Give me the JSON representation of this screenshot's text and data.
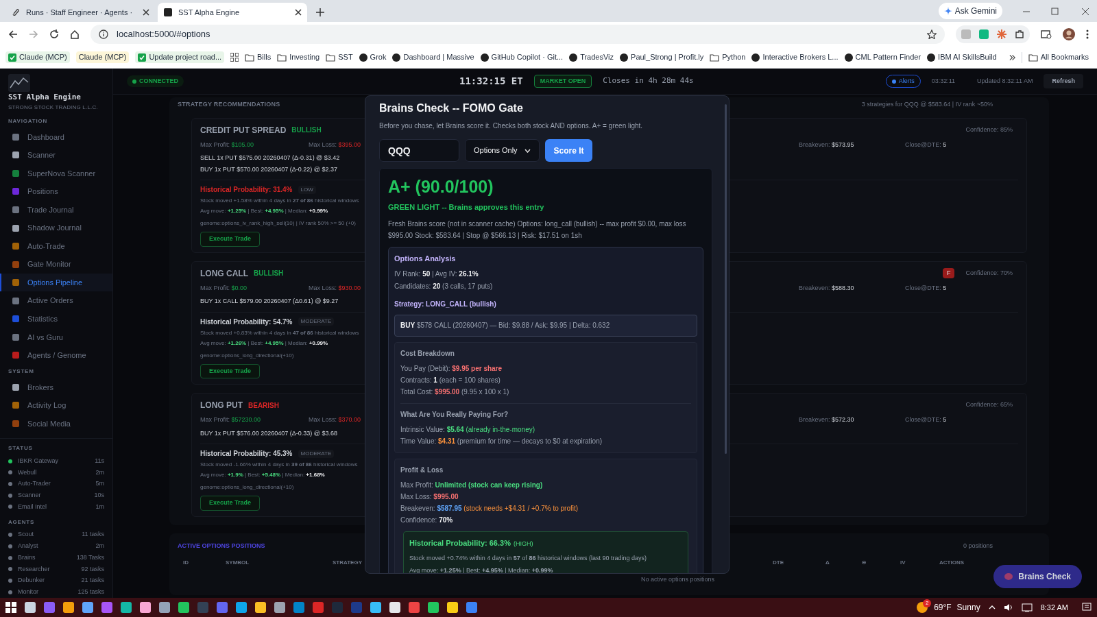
{
  "browser": {
    "tabs": [
      {
        "title": "Runs · Staff Engineer · Agents ·",
        "selected": false
      },
      {
        "title": "SST Alpha Engine",
        "selected": true
      }
    ],
    "address": "localhost:5000/#options",
    "profile_button": "Ask Gemini",
    "bookmarks": [
      {
        "label": "Claude (MCP)",
        "kind": "check"
      },
      {
        "label": "Claude (MCP)",
        "kind": "plain"
      },
      {
        "label": "Update project road...",
        "kind": "check"
      },
      {
        "kind": "apps"
      },
      {
        "label": "Bills",
        "kind": "folder"
      },
      {
        "label": "Investing",
        "kind": "folder"
      },
      {
        "label": "SST",
        "kind": "folder"
      },
      {
        "label": "Grok",
        "kind": "site"
      },
      {
        "label": "Dashboard | Massive",
        "kind": "site"
      },
      {
        "label": "GitHub Copilot · Git...",
        "kind": "site"
      },
      {
        "label": "TradesViz",
        "kind": "site"
      },
      {
        "label": "Paul_Strong | Profit.ly",
        "kind": "site"
      },
      {
        "label": "Python",
        "kind": "folder"
      },
      {
        "label": "Interactive Brokers L...",
        "kind": "site"
      },
      {
        "label": "CML Pattern Finder",
        "kind": "site"
      },
      {
        "label": "IBM AI SkillsBuild",
        "kind": "site"
      }
    ],
    "all_bookmarks": "All Bookmarks"
  },
  "sidebar": {
    "title": "SST Alpha Engine",
    "subtitle": "STRONG STOCK TRADING L.L.C.",
    "sections": [
      {
        "heading": "NAVIGATION",
        "items": [
          {
            "label": "Dashboard",
            "selected": false
          },
          {
            "label": "Scanner",
            "selected": false
          },
          {
            "label": "SuperNova Scanner",
            "selected": false
          },
          {
            "label": "Positions",
            "selected": false
          },
          {
            "label": "Trade Journal",
            "selected": false
          },
          {
            "label": "Shadow Journal",
            "selected": false
          },
          {
            "label": "Auto-Trade",
            "selected": false
          },
          {
            "label": "Gate Monitor",
            "selected": false
          },
          {
            "label": "Options Pipeline",
            "selected": true
          },
          {
            "label": "Active Orders",
            "selected": false
          },
          {
            "label": "Statistics",
            "selected": false
          },
          {
            "label": "AI vs Guru",
            "selected": false
          },
          {
            "label": "Agents / Genome",
            "selected": false
          }
        ]
      },
      {
        "heading": "SYSTEM",
        "items": [
          {
            "label": "Brokers",
            "selected": false
          },
          {
            "label": "Activity Log",
            "selected": false
          },
          {
            "label": "Social Media",
            "selected": false
          }
        ]
      }
    ],
    "status": {
      "heading": "STATUS",
      "items": [
        {
          "label": "IBKR Gateway",
          "value": "11s",
          "color": "#22c55e"
        },
        {
          "label": "Webull",
          "value": "2m",
          "color": "#6b7280"
        },
        {
          "label": "Auto-Trader",
          "value": "5m",
          "color": "#6b7280"
        },
        {
          "label": "Scanner",
          "value": "10s",
          "color": "#6b7280"
        },
        {
          "label": "Email Intel",
          "value": "1m",
          "color": "#6b7280"
        }
      ]
    },
    "agents": {
      "heading": "AGENTS",
      "items": [
        {
          "label": "Scout",
          "value": "11 tasks",
          "color": "#6b7280"
        },
        {
          "label": "Analyst",
          "value": "2m",
          "color": "#6b7280"
        },
        {
          "label": "Brains",
          "value": "138 Tasks",
          "color": "#6b7280"
        },
        {
          "label": "Researcher",
          "value": "92 tasks",
          "color": "#6b7280"
        },
        {
          "label": "Debunker",
          "value": "21 tasks",
          "color": "#6b7280"
        },
        {
          "label": "Monitor",
          "value": "125 tasks",
          "color": "#6b7280"
        }
      ]
    }
  },
  "header": {
    "connection": "CONNECTED",
    "clock": "11:32:15 ET",
    "market": "MARKET OPEN",
    "closes": "Closes in 4h 28m 44s",
    "alerts": "Alerts",
    "timer": "03:32:11",
    "updated": "Updated 8:32:11 AM",
    "refresh": "Refresh"
  },
  "strategies": {
    "heading": "STRATEGY RECOMMENDATIONS",
    "summary": "3 strategies for QQQ @ $583.64 | IV rank ~50%",
    "cards": [
      {
        "name": "CREDIT PUT SPREAD",
        "bias": {
          "label": "BULLISH",
          "color": "#16a34a"
        },
        "confidence": "Confidence: 85%",
        "max_profit": {
          "label": "Max Profit:",
          "value": "$105.00"
        },
        "max_loss": {
          "label": "Max Loss:",
          "value": "$395.00"
        },
        "breakeven": {
          "label": "Breakeven:",
          "value": "$573.95"
        },
        "close_dte": {
          "label": "Close@DTE:",
          "value": "5"
        },
        "legs": [
          "SELL 1x PUT $575.00 20260407 (Δ-0.31) @ $3.42",
          "BUY 1x PUT $570.00 20260407 (Δ-0.22) @ $2.37"
        ],
        "probability": {
          "label": "Historical Probability: 31.4%",
          "color": "#dc2626"
        },
        "probability_badge": "LOW",
        "moved": "Stock moved +1.58% within 4 days in **27 of 86** historical windows",
        "avg": [
          {
            "text": "Avg move: ",
            "kind": "dim"
          },
          {
            "text": "+1.25%",
            "kind": "green"
          },
          {
            "text": " | Best: ",
            "kind": "dim"
          },
          {
            "text": "+4.95%",
            "kind": "green"
          },
          {
            "text": " | Median: ",
            "kind": "dim"
          },
          {
            "text": "+0.99%",
            "kind": "bold"
          }
        ],
        "genome": "genome:options_iv_rank_high_sell(10) | IV rank 50% >= 50 (+0)",
        "button": "Execute Trade"
      },
      {
        "name": "LONG CALL",
        "bias": {
          "label": "BULLISH",
          "color": "#16a34a"
        },
        "grade": "F",
        "confidence": "Confidence: 70%",
        "max_profit": {
          "label": "Max Profit:",
          "value": "$0.00"
        },
        "max_loss": {
          "label": "Max Loss:",
          "value": "$930.00"
        },
        "breakeven": {
          "label": "Breakeven:",
          "value": "$588.30"
        },
        "close_dte": {
          "label": "Close@DTE:",
          "value": "5"
        },
        "legs": [
          "BUY 1x CALL $579.00 20260407 (Δ0.61) @ $9.27"
        ],
        "probability": {
          "label": "Historical Probability: 54.7%",
          "color": "#d1d5db"
        },
        "probability_badge": "MODERATE",
        "moved": "Stock moved +0.83% within 4 days in **47 of 86** historical windows",
        "avg": [
          {
            "text": "Avg move: ",
            "kind": "dim"
          },
          {
            "text": "+1.26%",
            "kind": "green"
          },
          {
            "text": " | Best: ",
            "kind": "dim"
          },
          {
            "text": "+4.95%",
            "kind": "green"
          },
          {
            "text": " | Median: ",
            "kind": "dim"
          },
          {
            "text": "+0.99%",
            "kind": "bold"
          }
        ],
        "genome": "genome:options_long_directional(+10)",
        "button": "Execute Trade"
      },
      {
        "name": "LONG PUT",
        "bias": {
          "label": "BEARISH",
          "color": "#dc2626"
        },
        "confidence": "Confidence: 65%",
        "max_profit": {
          "label": "Max Profit:",
          "value": "$57230.00"
        },
        "max_loss": {
          "label": "Max Loss:",
          "value": "$370.00"
        },
        "breakeven": {
          "label": "Breakeven:",
          "value": "$572.30"
        },
        "close_dte": {
          "label": "Close@DTE:",
          "value": "5"
        },
        "legs": [
          "BUY 1x PUT $576.00 20260407 (Δ-0.33) @ $3.68"
        ],
        "probability": {
          "label": "Historical Probability: 45.3%",
          "color": "#d1d5db"
        },
        "probability_badge": "MODERATE",
        "moved": "Stock moved -1.66% within 4 days in **39 of 86** historical windows",
        "avg": [
          {
            "text": "Avg move: ",
            "kind": "dim"
          },
          {
            "text": "+1.9%",
            "kind": "green"
          },
          {
            "text": " | Best: ",
            "kind": "dim"
          },
          {
            "text": "+5.48%",
            "kind": "green"
          },
          {
            "text": " | Median: ",
            "kind": "dim"
          },
          {
            "text": "+1.68%",
            "kind": "bold"
          }
        ],
        "genome": "genome:options_long_directional(+10)",
        "button": "Execute Trade"
      }
    ]
  },
  "positions": {
    "heading": "ACTIVE OPTIONS POSITIONS",
    "count": "0 positions",
    "columns": [
      "ID",
      "SYMBOL",
      "STRATEGY",
      "DTE",
      "Δ",
      "Θ",
      "IV",
      "ACTIONS"
    ],
    "empty": "No active options positions"
  },
  "floating_button": "Brains Check",
  "modal": {
    "title": "Brains Check -- FOMO Gate",
    "subtitle": "Before you chase, let Brains score it. Checks both stock AND options. A+ = green light.",
    "ticker": "QQQ",
    "mode": "Options Only",
    "submit": "Score It",
    "grade": "A+ (90.0/100)",
    "verdict": "GREEN LIGHT -- Brains approves this entry",
    "summary": "Fresh Brains score (not in scanner cache) Options: long_call (bullish) -- max profit $0.00, max loss $995.00 Stock: $583.64 | Stop @ $566.13 | Risk: $17.51 on 1sh",
    "analysis": {
      "title": "Options Analysis",
      "lines": [
        [
          {
            "text": "IV Rank: ",
            "kind": "plain"
          },
          {
            "text": "50",
            "kind": "bold"
          },
          {
            "text": " | Avg IV: ",
            "kind": "plain"
          },
          {
            "text": "26.1%",
            "kind": "bold"
          }
        ],
        [
          {
            "text": "Candidates: ",
            "kind": "plain"
          },
          {
            "text": "20",
            "kind": "bold"
          },
          {
            "text": " (3 calls, 17 puts)",
            "kind": "plain"
          }
        ]
      ],
      "strategy": "Strategy: LONG_CALL (bullish)",
      "leg": [
        {
          "text": "BUY",
          "kind": "bold"
        },
        {
          "text": " $578 CALL (20260407) — Bid: $9.88 / Ask: $9.95 | Delta: 0.632",
          "kind": "plain"
        }
      ],
      "groups": [
        {
          "sections": [
            {
              "title": "Cost Breakdown",
              "lines": [
                [
                  {
                    "text": "You Pay (Debit): ",
                    "kind": "plain"
                  },
                  {
                    "text": "$9.95 per share",
                    "kind": "red"
                  }
                ],
                [
                  {
                    "text": "Contracts: ",
                    "kind": "plain"
                  },
                  {
                    "text": "1",
                    "kind": "bold"
                  },
                  {
                    "text": " (each = 100 shares)",
                    "kind": "plain"
                  }
                ],
                [
                  {
                    "text": "Total Cost: ",
                    "kind": "plain"
                  },
                  {
                    "text": "$995.00",
                    "kind": "red"
                  },
                  {
                    "text": " (9.95 x 100 x 1)",
                    "kind": "plain"
                  }
                ]
              ]
            },
            {
              "title": "What Are You Really Paying For?",
              "lines": [
                [
                  {
                    "text": "Intrinsic Value: ",
                    "kind": "plain"
                  },
                  {
                    "text": "$5.64",
                    "kind": "green"
                  },
                  {
                    "text": " (already in-the-money)",
                    "kind": "greensoft"
                  }
                ],
                [
                  {
                    "text": "Time Value: ",
                    "kind": "plain"
                  },
                  {
                    "text": "$4.31",
                    "kind": "orange"
                  },
                  {
                    "text": " (premium for time — decays to $0 at expiration)",
                    "kind": "plain"
                  }
                ]
              ]
            }
          ]
        },
        {
          "sections": [
            {
              "title": "Profit & Loss",
              "lines": [
                [
                  {
                    "text": "Max Profit: ",
                    "kind": "plain"
                  },
                  {
                    "text": "Unlimited (stock can keep rising)",
                    "kind": "green"
                  }
                ],
                [
                  {
                    "text": "Max Loss: ",
                    "kind": "plain"
                  },
                  {
                    "text": "$995.00",
                    "kind": "red"
                  }
                ],
                [
                  {
                    "text": "Breakeven: ",
                    "kind": "plain"
                  },
                  {
                    "text": "$587.95",
                    "kind": "blue"
                  },
                  {
                    "text": " (stock needs +$4.31 / +0.7% to profit)",
                    "kind": "orangesoft"
                  }
                ],
                [
                  {
                    "text": "Confidence: ",
                    "kind": "plain"
                  },
                  {
                    "text": "70%",
                    "kind": "bold"
                  }
                ]
              ]
            }
          ],
          "probability": {
            "title": "Historical Probability: 66.3%",
            "level": "(HIGH)",
            "moved": "Stock moved +0.74% within 4 days in **57** of **86** historical windows (last 90 trading days)",
            "avg": "Avg move: **+1.25%** | Best: **+4.95%** | Median: **+0.99%**"
          }
        }
      ]
    }
  },
  "taskbar": {
    "temperature": "69°F",
    "weather": "Sunny",
    "weather_badge": "2",
    "time": "8:32 AM"
  }
}
